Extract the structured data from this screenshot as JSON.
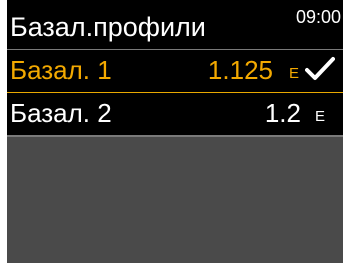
{
  "header": {
    "title": "Базал.профили",
    "clock": "09:00"
  },
  "profiles": [
    {
      "label": "Базал. 1",
      "amount": "1.125",
      "unit": "Е",
      "active": true,
      "state": "selected"
    },
    {
      "label": "Базал. 2",
      "amount": "1.2",
      "unit": "Е",
      "active": false,
      "state": "normal"
    }
  ],
  "colors": {
    "accent": "#f3a900",
    "accent_divider": "#e8a800",
    "header_background": "#000000",
    "row_background": "#000000",
    "empty_background": "#4a4a4a",
    "text": "#ffffff"
  },
  "icons": {
    "active_marker": "checkmark-icon"
  }
}
